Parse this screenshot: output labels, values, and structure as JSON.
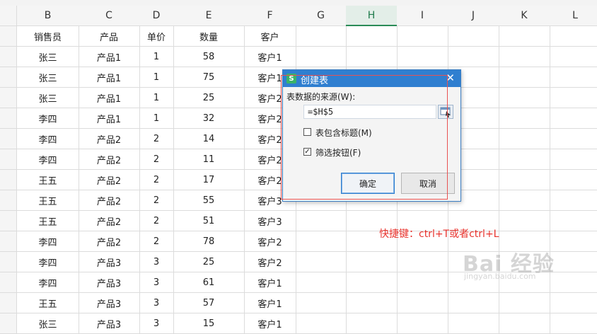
{
  "columns": [
    "B",
    "C",
    "D",
    "E",
    "F",
    "G",
    "H",
    "I",
    "J",
    "K",
    "L"
  ],
  "selected_column": "H",
  "table": {
    "headers": [
      "销售员",
      "产品",
      "单价",
      "数量",
      "客户"
    ],
    "rows": [
      [
        "张三",
        "产品1",
        "1",
        "58",
        "客户1"
      ],
      [
        "张三",
        "产品1",
        "1",
        "75",
        "客户1"
      ],
      [
        "张三",
        "产品1",
        "1",
        "25",
        "客户2"
      ],
      [
        "李四",
        "产品1",
        "1",
        "32",
        "客户2"
      ],
      [
        "李四",
        "产品2",
        "2",
        "14",
        "客户2"
      ],
      [
        "李四",
        "产品2",
        "2",
        "11",
        "客户2"
      ],
      [
        "王五",
        "产品2",
        "2",
        "17",
        "客户2"
      ],
      [
        "王五",
        "产品2",
        "2",
        "55",
        "客户3"
      ],
      [
        "王五",
        "产品2",
        "2",
        "51",
        "客户3"
      ],
      [
        "李四",
        "产品2",
        "2",
        "78",
        "客户2"
      ],
      [
        "李四",
        "产品3",
        "3",
        "25",
        "客户2"
      ],
      [
        "李四",
        "产品3",
        "3",
        "61",
        "客户1"
      ],
      [
        "王五",
        "产品3",
        "3",
        "57",
        "客户1"
      ],
      [
        "张三",
        "产品3",
        "3",
        "15",
        "客户1"
      ]
    ]
  },
  "dialog": {
    "logo": "S",
    "title": "创建表",
    "close": "✕",
    "source_label": "表数据的来源(W):",
    "source_value": "=$H$5",
    "include_header_label": "表包含标题(M)",
    "include_header_checked": false,
    "filter_button_label": "筛选按钮(F)",
    "filter_button_checked": true,
    "ok_label": "确定",
    "cancel_label": "取消"
  },
  "annotation": "快捷键：ctrl+T或者ctrl+L",
  "watermark": {
    "main": "Bai 经验",
    "sub": "jingyan.baidu.com"
  },
  "colors": {
    "dialog_title": "#2f7fd0",
    "header_selected": "#2a8b57",
    "annotation": "#e8332d"
  }
}
